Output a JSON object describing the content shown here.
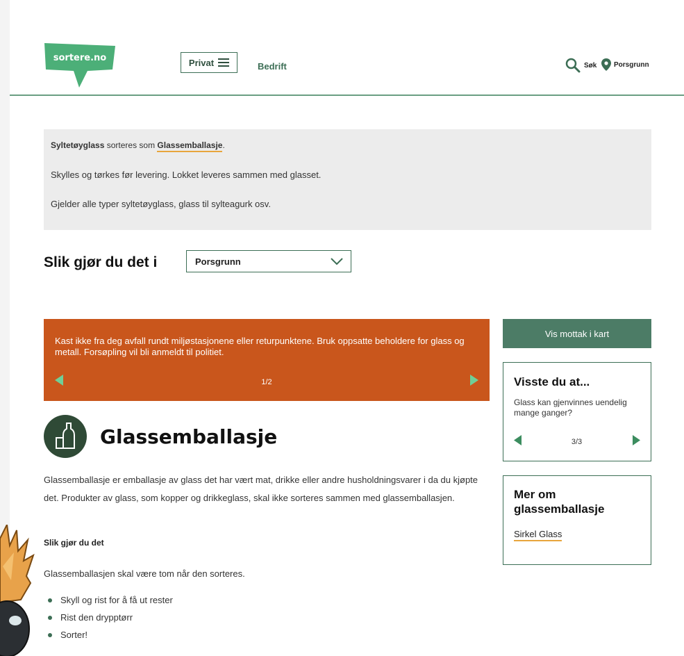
{
  "header": {
    "logo_text": "sortere.no",
    "privat_label": "Privat",
    "bedrift_label": "Bedrift",
    "search_label": "Søk",
    "location_label": "Porsgrunn"
  },
  "info": {
    "item": "Syltetøyglass",
    "sorted_as": "sorteres som",
    "category": "Glassemballasje",
    "period": ".",
    "line2": "Skylles og tørkes før levering. Lokket leveres sammen med glasset.",
    "line3": "Gjelder alle typer syltetøyglass, glass til sylteagurk osv."
  },
  "municipality": {
    "title": "Slik gjør du det i",
    "selected": "Porsgrunn"
  },
  "banner": {
    "message": "Kast ikke fra deg avfall rundt miljøstasjonene eller returpunktene. Bruk oppsatte beholdere for glass og metall. Forsøpling vil bli anmeldt til politiet.",
    "pager": "1/2"
  },
  "glass": {
    "title": "Glassemballasje",
    "description": "Glassemballasje er emballasje av glass det har vært mat, drikke eller andre husholdningsvarer i da du kjøpte det. Produkter av glass, som kopper og drikkeglass, skal ikke sorteres sammen med glassemballasjen.",
    "how_title": "Slik gjør du det",
    "how_text": "Glassemballasjen skal være tom når den sorteres.",
    "steps": [
      "Skyll og rist for å få ut rester",
      "Rist den drypptørr",
      "Sorter!"
    ]
  },
  "sidebar": {
    "map_button": "Vis mottak i kart",
    "facts_title": "Visste du at...",
    "facts_text": "Glass kan gjenvinnes uendelig mange ganger?",
    "facts_pager": "3/3",
    "more_title": "Mer om glassemballasje",
    "more_link": "Sirkel Glass"
  },
  "colors": {
    "brand_green": "#3c6e55",
    "logo_green": "#4caf78",
    "banner_orange": "#c9561c",
    "link_underline": "#e8a53c",
    "info_bg": "#ececec"
  }
}
